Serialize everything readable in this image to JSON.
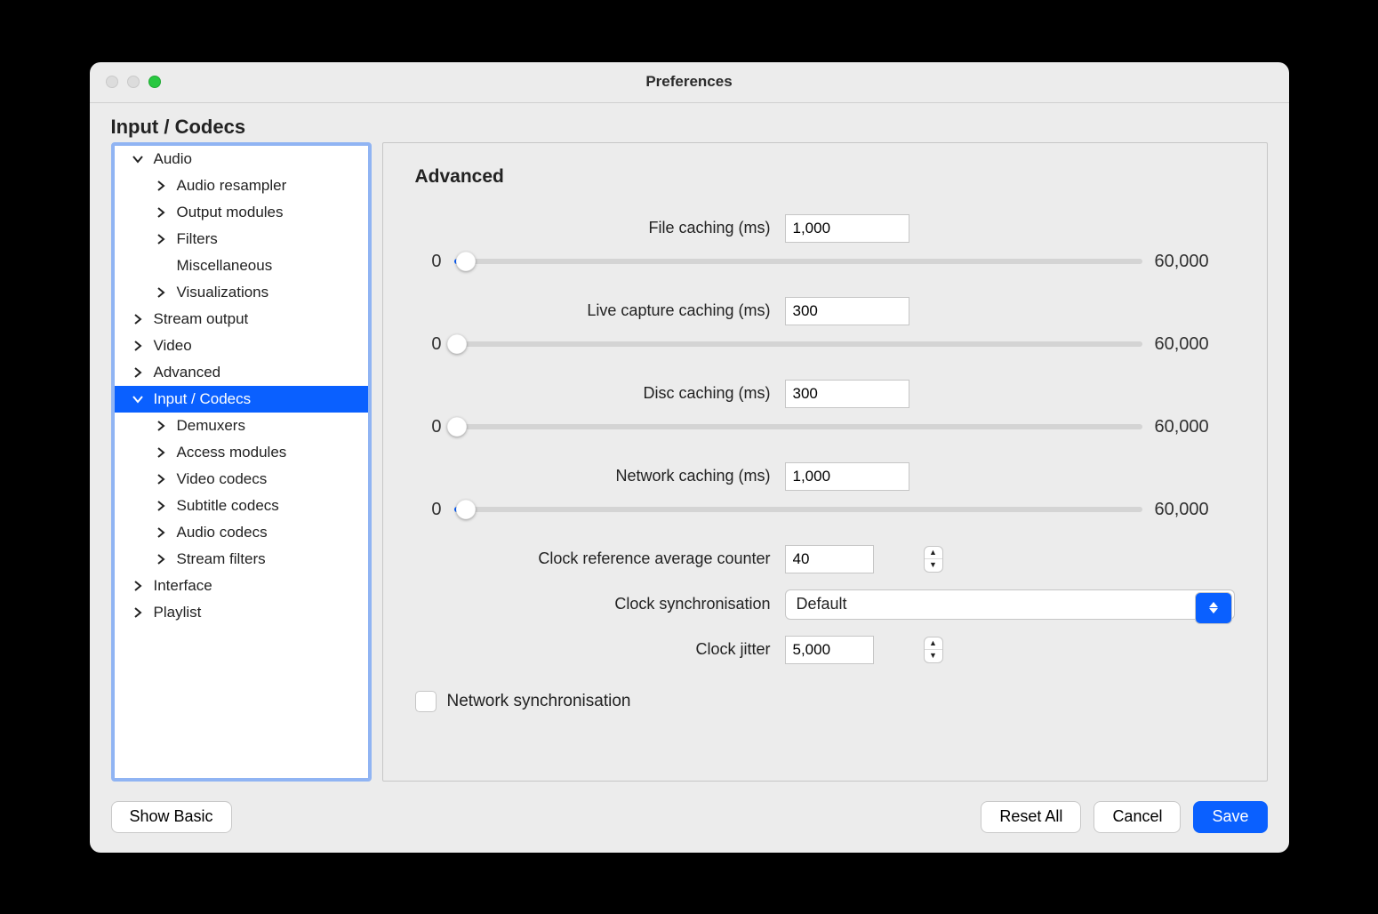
{
  "window": {
    "title": "Preferences"
  },
  "heading": "Input / Codecs",
  "sidebar": {
    "items": [
      {
        "expand": "down",
        "depth": 0,
        "label": "Audio"
      },
      {
        "expand": "right",
        "depth": 1,
        "label": "Audio resampler"
      },
      {
        "expand": "right",
        "depth": 1,
        "label": "Output modules"
      },
      {
        "expand": "right",
        "depth": 1,
        "label": "Filters"
      },
      {
        "expand": "none",
        "depth": 1,
        "label": "Miscellaneous"
      },
      {
        "expand": "right",
        "depth": 1,
        "label": "Visualizations"
      },
      {
        "expand": "right",
        "depth": 0,
        "label": "Stream output"
      },
      {
        "expand": "right",
        "depth": 0,
        "label": "Video"
      },
      {
        "expand": "right",
        "depth": 0,
        "label": "Advanced"
      },
      {
        "expand": "down",
        "depth": 0,
        "label": "Input / Codecs",
        "selected": true
      },
      {
        "expand": "right",
        "depth": 1,
        "label": "Demuxers"
      },
      {
        "expand": "right",
        "depth": 1,
        "label": "Access modules"
      },
      {
        "expand": "right",
        "depth": 1,
        "label": "Video codecs"
      },
      {
        "expand": "right",
        "depth": 1,
        "label": "Subtitle codecs"
      },
      {
        "expand": "right",
        "depth": 1,
        "label": "Audio codecs"
      },
      {
        "expand": "right",
        "depth": 1,
        "label": "Stream filters"
      },
      {
        "expand": "right",
        "depth": 0,
        "label": "Interface"
      },
      {
        "expand": "right",
        "depth": 0,
        "label": "Playlist"
      }
    ]
  },
  "pane": {
    "title": "Advanced",
    "labels": {
      "file_caching": "File caching (ms)",
      "live_caching": "Live capture caching (ms)",
      "disc_caching": "Disc caching (ms)",
      "network_caching": "Network caching (ms)",
      "clock_ref": "Clock reference average counter",
      "clock_sync": "Clock synchronisation",
      "clock_jitter": "Clock jitter",
      "net_sync": "Network synchronisation",
      "min": "0",
      "max": "60,000"
    },
    "values": {
      "file_caching": "1,000",
      "live_caching": "300",
      "disc_caching": "300",
      "network_caching": "1,000",
      "clock_ref": "40",
      "clock_sync": "Default",
      "clock_jitter": "5,000"
    },
    "slider_pct": {
      "file_caching": 1.7,
      "live_caching": 0.5,
      "disc_caching": 0.5,
      "network_caching": 1.7
    }
  },
  "footer": {
    "show_basic": "Show Basic",
    "reset": "Reset All",
    "cancel": "Cancel",
    "save": "Save"
  }
}
